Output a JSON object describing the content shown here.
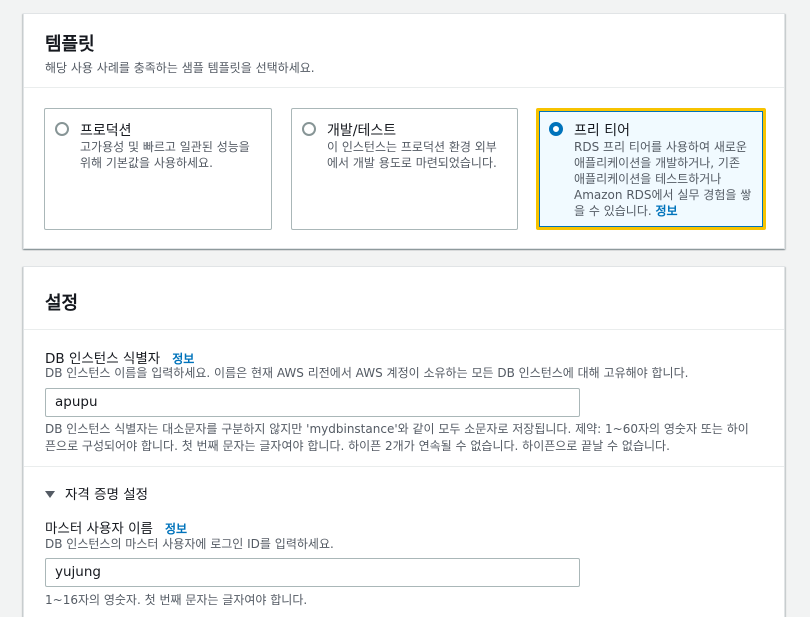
{
  "template": {
    "title": "템플릿",
    "description": "해당 사용 사례를 충족하는 샘플 템플릿을 선택하세요.",
    "options": [
      {
        "label": "프로덕션",
        "desc1": "고가용성 및 빠르고 일관된 성능을",
        "desc2": "위해 기본값을 사용하세요.",
        "selected": false
      },
      {
        "label": "개발/테스트",
        "desc1": "이 인스턴스는 프로덕션 환경 외부",
        "desc2": "에서 개발 용도로 마련되었습니다.",
        "selected": false
      },
      {
        "label": "프리 티어",
        "desc1": "RDS 프리 티어를 사용하여 새로운",
        "desc2": "애플리케이션을 개발하거나, 기존",
        "desc3": "애플리케이션을 테스트하거나",
        "desc4": "Amazon RDS에서 실무 경험을 쌓",
        "desc5": "을 수 있습니다.",
        "info": "정보",
        "selected": true
      }
    ]
  },
  "settings": {
    "title": "설정",
    "db_identifier": {
      "label": "DB 인스턴스 식별자",
      "info": "정보",
      "description": "DB 인스턴스 이름을 입력하세요. 이름은 현재 AWS 리전에서 AWS 계정이 소유하는 모든 DB 인스턴스에 대해 고유해야 합니다.",
      "value": "apupu",
      "constraint1": "DB 인스턴스 식별자는 대소문자를 구분하지 않지만 'mydbinstance'와 같이 모두 소문자로 저장됩니다. 제약: 1~60자의 영숫자 또는 하이",
      "constraint2": "픈으로 구성되어야 합니다. 첫 번째 문자는 글자여야 합니다. 하이픈 2개가 연속될 수 없습니다. 하이픈으로 끝날 수 없습니다."
    },
    "credentials": {
      "section_label": "자격 증명 설정",
      "master_username": {
        "label": "마스터 사용자 이름",
        "info": "정보",
        "description": "DB 인스턴스의 마스터 사용자에 로그인 ID를 입력하세요.",
        "value": "yujung",
        "constraint": "1~16자의 영숫자. 첫 번째 문자는 글자여야 합니다."
      }
    }
  },
  "colors": {
    "accent": "#0073bb",
    "selected_border": "#f7c300"
  }
}
